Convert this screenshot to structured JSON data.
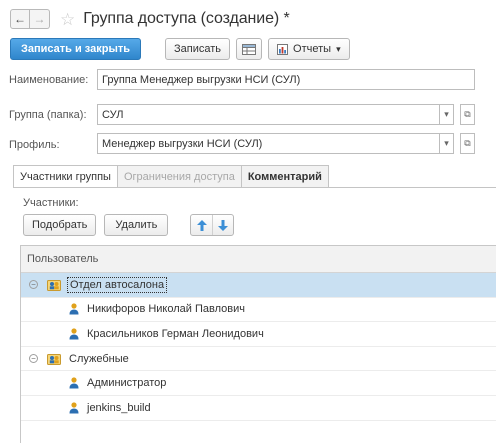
{
  "window": {
    "title": "Группа доступа (создание) *",
    "back_glyph": "←",
    "forward_glyph": "→",
    "star_glyph": "☆"
  },
  "toolbar": {
    "save_close_label": "Записать и закрыть",
    "save_label": "Записать",
    "reports_label": "Отчеты",
    "reports_arrow": "▾"
  },
  "form": {
    "name_label": "Наименование:",
    "name_value": "Группа Менеджер выгрузки НСИ (СУЛ)",
    "group_label": "Группа (папка):",
    "group_value": "СУЛ",
    "profile_label": "Профиль:",
    "profile_value": "Менеджер выгрузки НСИ (СУЛ)",
    "dropdown_glyph": "▾",
    "open_glyph": "⧉"
  },
  "tabs": [
    {
      "label": "Участники группы",
      "state": "active"
    },
    {
      "label": "Ограничения доступа",
      "state": "disabled"
    },
    {
      "label": "Комментарий",
      "state": "normal"
    }
  ],
  "participants": {
    "label": "Участники:",
    "pick_label": "Подобрать",
    "delete_label": "Удалить",
    "up_glyph": "🡅",
    "down_glyph": "🡇",
    "column_header": "Пользователь",
    "collapse_glyph": "−"
  },
  "rows": [
    {
      "text": "Отдел автосалона",
      "kind": "group",
      "selected": true
    },
    {
      "text": "Никифоров Николай Павлович",
      "kind": "user",
      "selected": false
    },
    {
      "text": "Красильников Герман Леонидович",
      "kind": "user",
      "selected": false
    },
    {
      "text": "Служебные",
      "kind": "group",
      "selected": false
    },
    {
      "text": "Администратор",
      "kind": "user",
      "selected": false
    },
    {
      "text": "jenkins_build",
      "kind": "user",
      "selected": false
    }
  ],
  "colors": {
    "primary_button": "#2f86cc",
    "selected_row": "#c9e0f2",
    "user_icon": "#e0a11b"
  }
}
